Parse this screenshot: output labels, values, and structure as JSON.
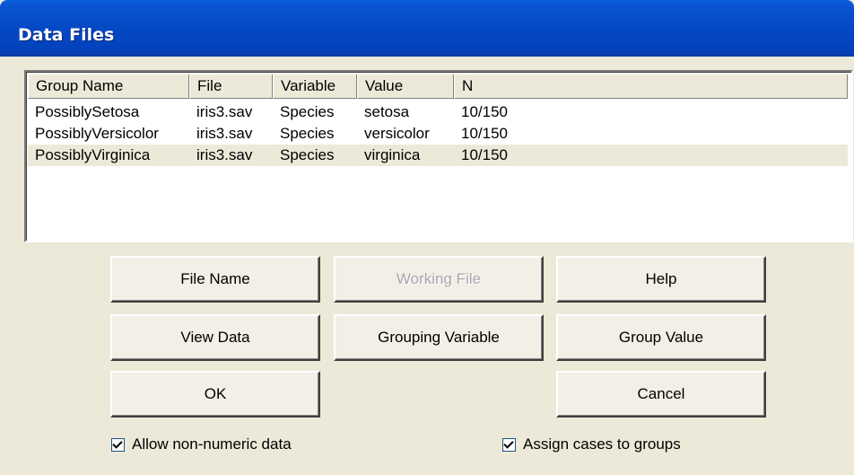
{
  "window": {
    "title": "Data Files"
  },
  "listview": {
    "columns": [
      "Group Name",
      "File",
      "Variable",
      "Value",
      "N"
    ],
    "rows": [
      [
        "PossiblySetosa",
        "iris3.sav",
        "Species",
        "setosa",
        "10/150"
      ],
      [
        "PossiblyVersicolor",
        "iris3.sav",
        "Species",
        "versicolor",
        "10/150"
      ],
      [
        "PossiblyVirginica",
        "iris3.sav",
        "Species",
        "virginica",
        "10/150"
      ]
    ],
    "selected_row": 2
  },
  "buttons": {
    "file_name": "File Name",
    "working_file": "Working File",
    "help": "Help",
    "view_data": "View Data",
    "grouping_variable": "Grouping Variable",
    "group_value": "Group Value",
    "ok": "OK",
    "cancel": "Cancel"
  },
  "checkboxes": {
    "allow_non_numeric": {
      "label": "Allow non-numeric data",
      "checked": true
    },
    "assign_cases": {
      "label": "Assign cases to groups",
      "checked": true
    }
  }
}
